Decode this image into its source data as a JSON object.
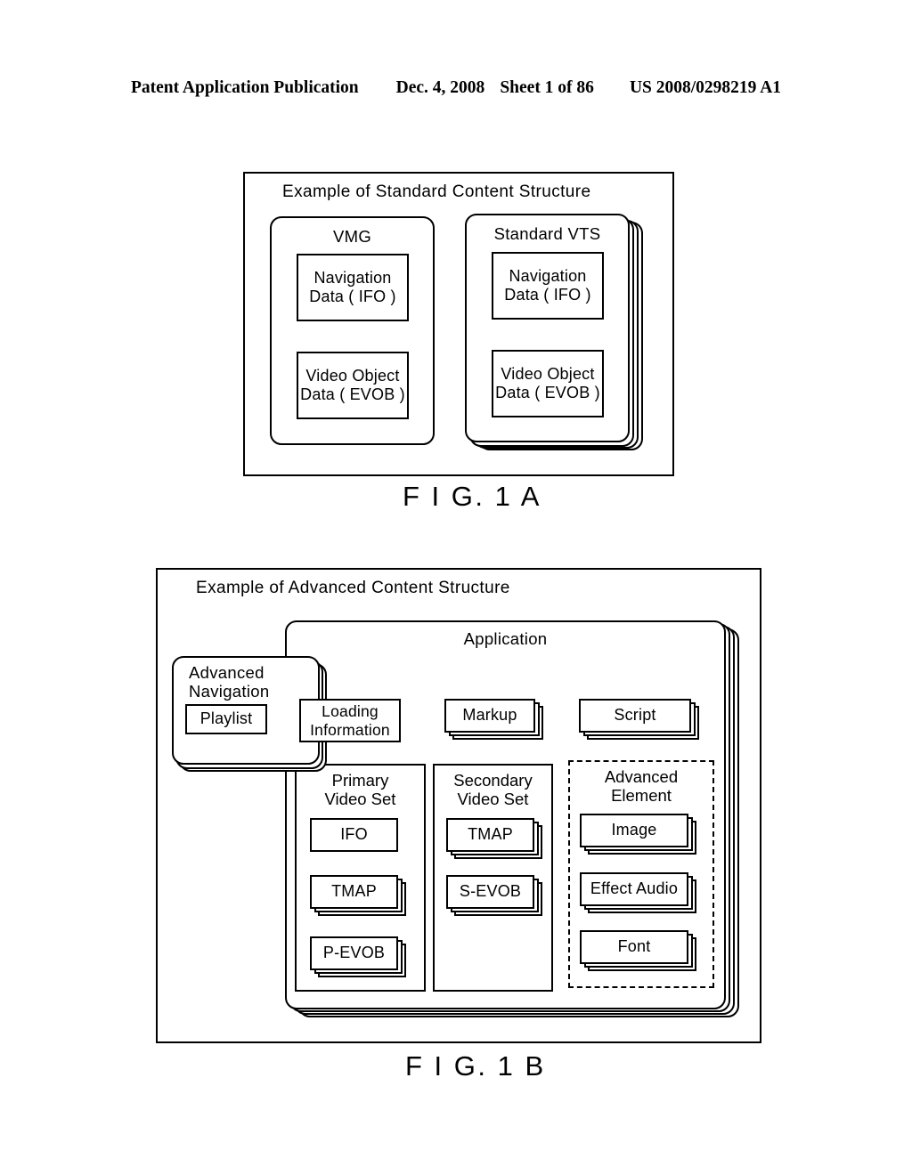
{
  "header": {
    "publication": "Patent Application Publication",
    "date": "Dec. 4, 2008",
    "sheet": "Sheet 1 of 86",
    "docnum": "US 2008/0298219 A1"
  },
  "figures": [
    {
      "id": "fig1a",
      "caption": "F I G. 1 A",
      "title": "Example of Standard Content Structure",
      "cards": [
        {
          "name": "vmg",
          "label": "VMG",
          "stack_count": 0,
          "items": [
            {
              "name": "navigation-data",
              "lines": [
                "Navigation",
                "Data ( IFO )"
              ]
            },
            {
              "name": "video-object-data",
              "lines": [
                "Video Object",
                "Data ( EVOB )"
              ]
            }
          ]
        },
        {
          "name": "standard-vts",
          "label": "Standard VTS",
          "stack_count": 3,
          "items": [
            {
              "name": "navigation-data",
              "lines": [
                "Navigation",
                "Data ( IFO )"
              ]
            },
            {
              "name": "video-object-data",
              "lines": [
                "Video Object",
                "Data ( EVOB )"
              ]
            }
          ]
        }
      ]
    },
    {
      "id": "fig1b",
      "caption": "F I G. 1 B",
      "title": "Example of Advanced Content Structure",
      "application": {
        "label": "Application",
        "stack_count": 3
      },
      "advanced_navigation": {
        "label_lines": [
          "Advanced",
          "Navigation"
        ],
        "stack_count": 2,
        "items": [
          {
            "name": "playlist",
            "label": "Playlist",
            "stack_count": 0
          }
        ]
      },
      "application_items": [
        {
          "name": "loading-information",
          "lines": [
            "Loading",
            "Information"
          ],
          "stack_count": 0
        },
        {
          "name": "markup",
          "lines": [
            "Markup"
          ],
          "stack_count": 2
        },
        {
          "name": "script",
          "lines": [
            "Script"
          ],
          "stack_count": 2
        }
      ],
      "columns": [
        {
          "name": "primary-video-set",
          "label_lines": [
            "Primary",
            "Video Set"
          ],
          "style": "solid",
          "items": [
            {
              "name": "ifo",
              "label": "IFO",
              "stack_count": 0
            },
            {
              "name": "tmap",
              "label": "TMAP",
              "stack_count": 2
            },
            {
              "name": "p-evob",
              "label": "P-EVOB",
              "stack_count": 2
            }
          ]
        },
        {
          "name": "secondary-video-set",
          "label_lines": [
            "Secondary",
            "Video Set"
          ],
          "style": "solid",
          "items": [
            {
              "name": "tmap",
              "label": "TMAP",
              "stack_count": 2
            },
            {
              "name": "s-evob",
              "label": "S-EVOB",
              "stack_count": 2
            }
          ]
        },
        {
          "name": "advanced-element",
          "label_lines": [
            "Advanced",
            "Element"
          ],
          "style": "dashed",
          "items": [
            {
              "name": "image",
              "label": "Image",
              "stack_count": 2
            },
            {
              "name": "effect-audio",
              "label": "Effect Audio",
              "stack_count": 2
            },
            {
              "name": "font",
              "label": "Font",
              "stack_count": 2
            }
          ]
        }
      ]
    }
  ]
}
